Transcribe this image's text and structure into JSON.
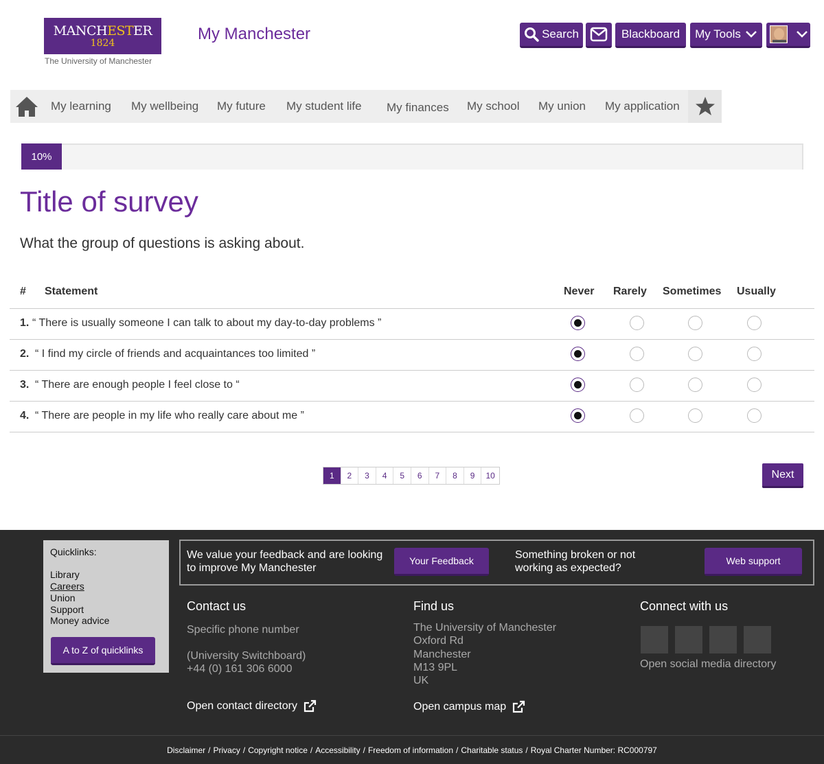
{
  "header": {
    "logo": {
      "line1_a": "MANCH",
      "line1_b": "EST",
      "line1_c": "ER",
      "year": "1824",
      "sub": "The University of Manchester"
    },
    "site_title": "My Manchester",
    "search_label": "Search",
    "blackboard_label": "Blackboard",
    "mytools_label": "My Tools"
  },
  "nav": {
    "items": [
      "My learning",
      "My wellbeing",
      "My future",
      "My student life",
      "My finances",
      "My school",
      "My union",
      "My application"
    ]
  },
  "progress": {
    "label": "10%",
    "value": 0.1
  },
  "survey": {
    "title": "Title of survey",
    "subtitle": "What the group of questions is asking about.",
    "columns": {
      "num": "#",
      "statement": "Statement",
      "options": [
        "Never",
        "Rarely",
        "Sometimes",
        "Usually"
      ]
    },
    "questions": [
      {
        "num": "1.",
        "text": "“ There is usually someone I can talk to about my day-to-day problems ”",
        "selected": "Never"
      },
      {
        "num": "2.",
        "text": "“ I find my circle of friends and acquaintances too limited ”",
        "selected": "Never"
      },
      {
        "num": "3.",
        "text": "“ There are enough people I feel close to “",
        "selected": "Never"
      },
      {
        "num": "4.",
        "text": "“ There are people in my life who really care about me ”",
        "selected": "Never"
      }
    ]
  },
  "pagination": {
    "pages": [
      "1",
      "2",
      "3",
      "4",
      "5",
      "6",
      "7",
      "8",
      "9",
      "10"
    ],
    "current": "1",
    "next_label": "Next"
  },
  "footer": {
    "quicklinks": {
      "title": "Quicklinks:",
      "links": [
        "Library",
        "Careers",
        "Union",
        "Support",
        "Money advice"
      ],
      "button": "A to Z of quicklinks"
    },
    "feedback": {
      "text": "We value your feedback and are looking to improve My Manchester",
      "button": "Your Feedback"
    },
    "support": {
      "text": "Something broken or not working as expected?",
      "button": "Web support"
    },
    "contact": {
      "heading": "Contact us",
      "line1": "Specific phone number",
      "line2": "(University Switchboard)",
      "line3": "+44 (0) 161 306 6000",
      "link": "Open contact directory"
    },
    "find": {
      "heading": "Find us",
      "address": [
        "The University of Manchester",
        "Oxford Rd",
        "Manchester",
        "M13 9PL",
        "UK"
      ],
      "link": "Open campus map"
    },
    "connect": {
      "heading": "Connect with us",
      "link": "Open social media directory"
    },
    "bottom_links": [
      "Disclaimer",
      "Privacy",
      "Copyright notice",
      "Accessibility",
      "Freedom of information",
      "Charitable status"
    ],
    "charter": "Royal Charter Number: RC000797"
  },
  "colors": {
    "brand_purple": "#5a2a85",
    "title_purple": "#6b2c9b",
    "footer_bg": "#2b2b2b"
  }
}
